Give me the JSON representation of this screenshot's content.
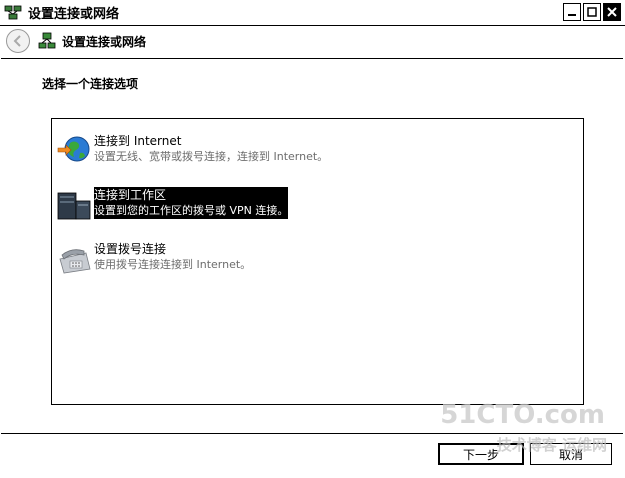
{
  "window": {
    "title": "设置连接或网络"
  },
  "nav": {
    "title": "设置连接或网络"
  },
  "page": {
    "heading": "选择一个连接选项"
  },
  "options": [
    {
      "title": "连接到 Internet",
      "desc": "设置无线、宽带或拨号连接，连接到 Internet。",
      "icon": "globe-icon",
      "selected": false
    },
    {
      "title": "连接到工作区",
      "desc": "设置到您的工作区的拨号或 VPN 连接。",
      "icon": "workplace-icon",
      "selected": true
    },
    {
      "title": "设置拨号连接",
      "desc": "使用拨号连接连接到 Internet。",
      "icon": "telephone-icon",
      "selected": false
    }
  ],
  "buttons": {
    "next": "下一步",
    "cancel": "取消"
  },
  "watermark": {
    "line1": "51CTO.com",
    "line2": "技术博客 运维网"
  }
}
